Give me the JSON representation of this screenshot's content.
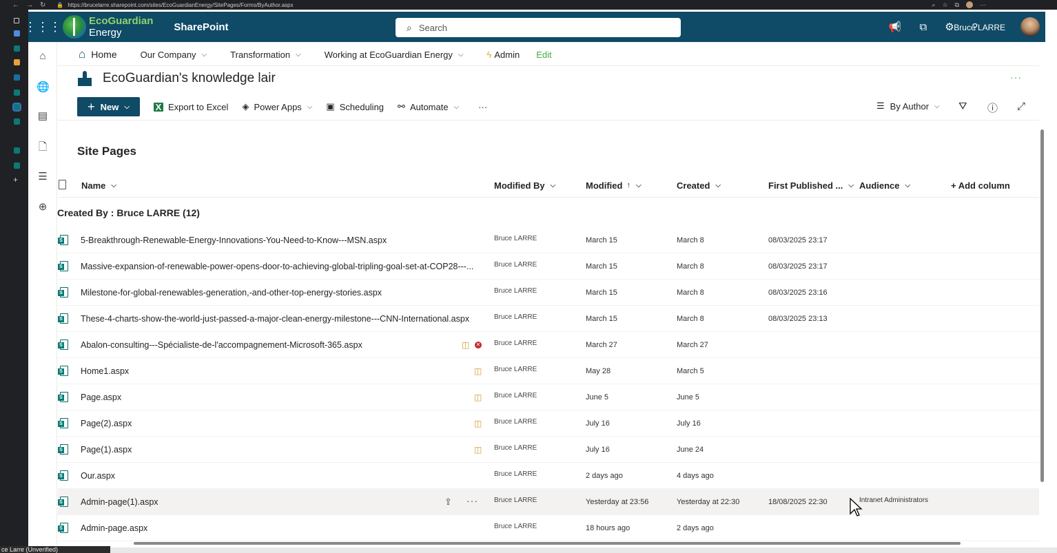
{
  "browser": {
    "url": "https://brucelarre.sharepoint.com/sites/EcoGuardianEnergy/SitePages/Forms/ByAuthor.aspx",
    "profile_label": "ce Larre (Unverified)"
  },
  "suite": {
    "logo_top": "EcoGuardian",
    "logo_bottom": "Energy",
    "app_name": "SharePoint",
    "search_placeholder": "Search",
    "user_name": "Bruce LARRE",
    "help_glyph": "?"
  },
  "hub_nav": {
    "home": "Home",
    "items": [
      "Our Company",
      "Transformation",
      "Working at EcoGuardian Energy"
    ],
    "admin": "Admin",
    "edit": "Edit"
  },
  "site": {
    "title": "EcoGuardian's knowledge lair",
    "more": "···"
  },
  "commands": {
    "new": "New",
    "export": "Export to Excel",
    "power_apps": "Power Apps",
    "scheduling": "Scheduling",
    "automate": "Automate",
    "more": "···",
    "view": "By Author"
  },
  "list": {
    "title": "Site Pages",
    "columns": {
      "name": "Name",
      "modified_by": "Modified By",
      "modified": "Modified",
      "created": "Created",
      "first_published": "First Published ...",
      "audience": "Audience",
      "add_column": "+ Add column"
    },
    "group": "Created By : Bruce LARRE (12)",
    "rows": [
      {
        "name": "5-Breakthrough-Renewable-Energy-Innovations-You-Need-to-Know---MSN.aspx",
        "modified_by": "Bruce LARRE",
        "modified": "March 15",
        "created": "March 8",
        "first_published": "08/03/2025 23:17",
        "audience": ""
      },
      {
        "name": "Massive-expansion-of-renewable-power-opens-door-to-achieving-global-tripling-goal-set-at-COP28---...",
        "modified_by": "Bruce LARRE",
        "modified": "March 15",
        "created": "March 8",
        "first_published": "08/03/2025 23:17",
        "audience": ""
      },
      {
        "name": "Milestone-for-global-renewables-generation,-and-other-top-energy-stories.aspx",
        "modified_by": "Bruce LARRE",
        "modified": "March 15",
        "created": "March 8",
        "first_published": "08/03/2025 23:16",
        "audience": ""
      },
      {
        "name": "These-4-charts-show-the-world-just-passed-a-major-clean-energy-milestone---CNN-International.aspx",
        "modified_by": "Bruce LARRE",
        "modified": "March 15",
        "created": "March 8",
        "first_published": "08/03/2025 23:13",
        "audience": ""
      },
      {
        "name": "Abalon-consulting---Spécialiste-de-l'accompagnement-Microsoft-365.aspx",
        "modified_by": "Bruce LARRE",
        "modified": "March 27",
        "created": "March 27",
        "first_published": "",
        "audience": ""
      },
      {
        "name": "Home1.aspx",
        "modified_by": "Bruce LARRE",
        "modified": "May 28",
        "created": "March 5",
        "first_published": "",
        "audience": ""
      },
      {
        "name": "Page.aspx",
        "modified_by": "Bruce LARRE",
        "modified": "June 5",
        "created": "June 5",
        "first_published": "",
        "audience": ""
      },
      {
        "name": "Page(2).aspx",
        "modified_by": "Bruce LARRE",
        "modified": "July 16",
        "created": "July 16",
        "first_published": "",
        "audience": ""
      },
      {
        "name": "Page(1).aspx",
        "modified_by": "Bruce LARRE",
        "modified": "July 16",
        "created": "June 24",
        "first_published": "",
        "audience": ""
      },
      {
        "name": "Our.aspx",
        "modified_by": "Bruce LARRE",
        "modified": "2 days ago",
        "created": "4 days ago",
        "first_published": "",
        "audience": ""
      },
      {
        "name": "Admin-page(1).aspx",
        "modified_by": "Bruce LARRE",
        "modified": "Yesterday at 23:56",
        "created": "Yesterday at 22:30",
        "first_published": "18/08/2025 22:30",
        "audience": "Intranet Administrators"
      },
      {
        "name": "Admin-page.aspx",
        "modified_by": "Bruce LARRE",
        "modified": "18 hours ago",
        "created": "2 days ago",
        "first_published": "",
        "audience": ""
      }
    ]
  },
  "colors": {
    "suite_bar": "#0f4a66",
    "accent_green": "#3fae3f",
    "checkout": "#d49a2a",
    "error": "#c4262e"
  }
}
